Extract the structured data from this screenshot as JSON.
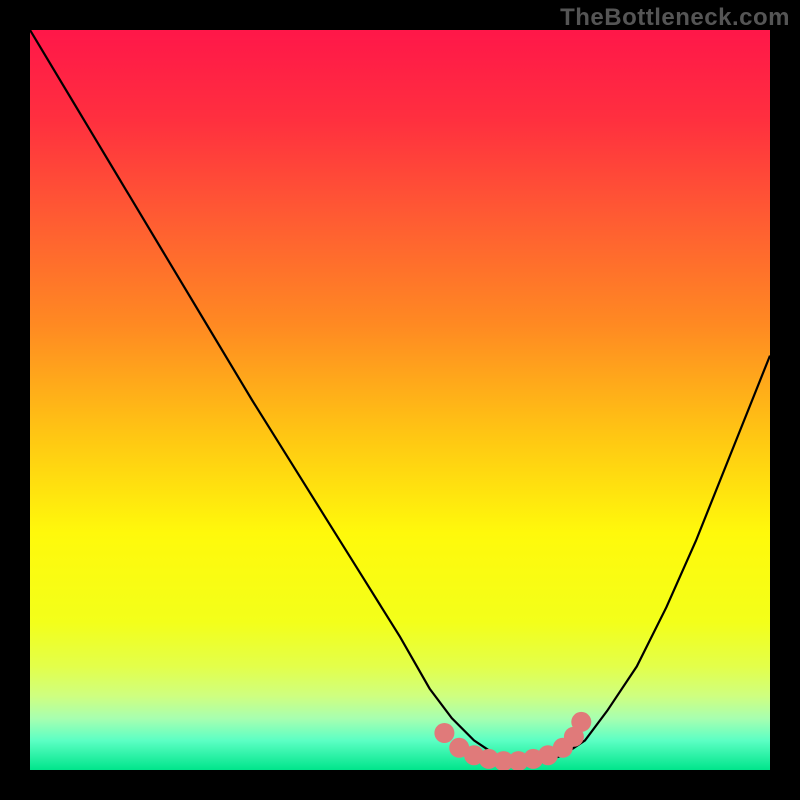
{
  "watermark": "TheBottleneck.com",
  "chart_data": {
    "type": "line",
    "title": "",
    "xlabel": "",
    "ylabel": "",
    "xlim": [
      0,
      100
    ],
    "ylim": [
      0,
      100
    ],
    "gradient_stops": [
      {
        "offset": 0.0,
        "color": "#ff1749"
      },
      {
        "offset": 0.12,
        "color": "#ff2f3f"
      },
      {
        "offset": 0.25,
        "color": "#ff5a33"
      },
      {
        "offset": 0.4,
        "color": "#ff8a22"
      },
      {
        "offset": 0.55,
        "color": "#ffc713"
      },
      {
        "offset": 0.68,
        "color": "#fff90b"
      },
      {
        "offset": 0.8,
        "color": "#f3ff1a"
      },
      {
        "offset": 0.86,
        "color": "#e3ff4a"
      },
      {
        "offset": 0.9,
        "color": "#cfff80"
      },
      {
        "offset": 0.93,
        "color": "#a8ffb0"
      },
      {
        "offset": 0.96,
        "color": "#5cffc4"
      },
      {
        "offset": 1.0,
        "color": "#00e58b"
      }
    ],
    "series": [
      {
        "name": "curve",
        "x": [
          0,
          6,
          12,
          18,
          24,
          30,
          35,
          40,
          45,
          50,
          54,
          57,
          60,
          63,
          66,
          69,
          72,
          75,
          78,
          82,
          86,
          90,
          94,
          98,
          100
        ],
        "y": [
          100,
          90,
          80,
          70,
          60,
          50,
          42,
          34,
          26,
          18,
          11,
          7,
          4,
          2,
          1,
          1,
          2,
          4,
          8,
          14,
          22,
          31,
          41,
          51,
          56
        ]
      }
    ],
    "markers": {
      "name": "highlight-band",
      "color": "#e07a7a",
      "points": [
        {
          "x": 56,
          "y": 5
        },
        {
          "x": 58,
          "y": 3
        },
        {
          "x": 60,
          "y": 2
        },
        {
          "x": 62,
          "y": 1.5
        },
        {
          "x": 64,
          "y": 1.2
        },
        {
          "x": 66,
          "y": 1.2
        },
        {
          "x": 68,
          "y": 1.5
        },
        {
          "x": 70,
          "y": 2
        },
        {
          "x": 72,
          "y": 3
        },
        {
          "x": 73.5,
          "y": 4.5
        },
        {
          "x": 74.5,
          "y": 6.5
        }
      ]
    }
  }
}
